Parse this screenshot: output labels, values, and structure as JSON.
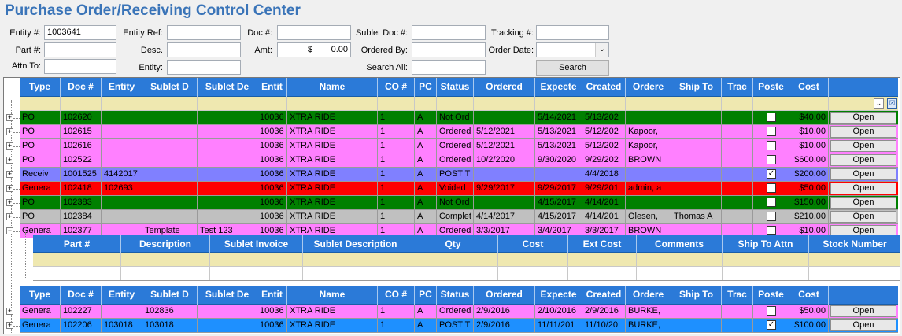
{
  "title": "Purchase Order/Receiving Control Center",
  "form": {
    "entity_num_label": "Entity #:",
    "entity_num_value": "1003641",
    "part_num_label": "Part #:",
    "part_num_value": "",
    "attn_to_label": "Attn To:",
    "attn_to_value": "",
    "entity_ref_label": "Entity Ref:",
    "entity_ref_value": "",
    "desc_label": "Desc.",
    "desc_value": "",
    "entity_label": "Entity:",
    "entity_value": "",
    "doc_num_label": "Doc #:",
    "doc_num_value": "",
    "amt_label": "Amt:",
    "amt_currency": "$",
    "amt_value": "0.00",
    "sublet_doc_label": "Sublet Doc #:",
    "sublet_doc_value": "",
    "ordered_by_label": "Ordered By:",
    "ordered_by_value": "",
    "search_all_label": "Search All:",
    "search_all_value": "",
    "tracking_label": "Tracking #:",
    "tracking_value": "",
    "order_date_label": "Order Date:",
    "order_date_value": "",
    "search_button": "Search"
  },
  "grid": {
    "columns": [
      "Type",
      "Doc #",
      "Entity",
      "Sublet D",
      "Sublet De",
      "Entit",
      "Name",
      "CO #",
      "PC",
      "Status",
      "Ordered",
      "Expecte",
      "Created",
      "Ordere",
      "Ship To",
      "Trac",
      "Poste",
      "Cost"
    ],
    "rows": [
      {
        "bg": "#008000",
        "cells": [
          "PO",
          "102620",
          "",
          "",
          "",
          "10036",
          "XTRA RIDE",
          "1",
          "A",
          "Not Ord",
          "",
          "5/14/2021",
          "5/13/202",
          "",
          "",
          "",
          ""
        ],
        "posted": false,
        "cost": "$40.00",
        "open": "Open"
      },
      {
        "bg": "#ff80ff",
        "cells": [
          "PO",
          "102615",
          "",
          "",
          "",
          "10036",
          "XTRA RIDE",
          "1",
          "A",
          "Ordered",
          "5/12/2021",
          "5/13/2021",
          "5/12/202",
          "Kapoor,",
          "",
          "",
          ""
        ],
        "posted": false,
        "cost": "$10.00",
        "open": "Open"
      },
      {
        "bg": "#ff80ff",
        "cells": [
          "PO",
          "102616",
          "",
          "",
          "",
          "10036",
          "XTRA RIDE",
          "1",
          "A",
          "Ordered",
          "5/12/2021",
          "5/13/2021",
          "5/12/202",
          "Kapoor,",
          "",
          "",
          ""
        ],
        "posted": false,
        "cost": "$10.00",
        "open": "Open"
      },
      {
        "bg": "#ff80ff",
        "cells": [
          "PO",
          "102522",
          "",
          "",
          "",
          "10036",
          "XTRA RIDE",
          "1",
          "A",
          "Ordered",
          "10/2/2020",
          "9/30/2020",
          "9/29/202",
          "BROWN",
          "",
          "",
          ""
        ],
        "posted": false,
        "cost": "$600.00",
        "open": "Open"
      },
      {
        "bg": "#8080ff",
        "cells": [
          "Receiv",
          "1001525",
          "4142017",
          "",
          "",
          "10036",
          "XTRA RIDE",
          "1",
          "A",
          "POST T",
          "",
          "",
          "4/4/2018",
          "",
          "",
          "",
          ""
        ],
        "posted": true,
        "cost": "$200.00",
        "open": "Open"
      },
      {
        "bg": "#ff0000",
        "cells": [
          "Genera",
          "102418",
          "102693",
          "",
          "",
          "10036",
          "XTRA RIDE",
          "1",
          "A",
          "Voided",
          "9/29/2017",
          "9/29/2017",
          "9/29/201",
          "admin, a",
          "",
          "",
          ""
        ],
        "posted": false,
        "cost": "$50.00",
        "open": "Open"
      },
      {
        "bg": "#008000",
        "cells": [
          "PO",
          "102383",
          "",
          "",
          "",
          "10036",
          "XTRA RIDE",
          "1",
          "A",
          "Not Ord",
          "",
          "4/15/2017",
          "4/14/201",
          "",
          "",
          "",
          ""
        ],
        "posted": false,
        "cost": "$150.00",
        "open": "Open"
      },
      {
        "bg": "#c0c0c0",
        "cells": [
          "PO",
          "102384",
          "",
          "",
          "",
          "10036",
          "XTRA RIDE",
          "1",
          "A",
          "Complet",
          "4/14/2017",
          "4/15/2017",
          "4/14/201",
          "Olesen,",
          "Thomas A",
          "",
          ""
        ],
        "posted": false,
        "cost": "$210.00",
        "open": "Open"
      },
      {
        "bg": "#ff80ff",
        "cells": [
          "Genera",
          "102377",
          "",
          "Template",
          "Test 123",
          "10036",
          "XTRA RIDE",
          "1",
          "A",
          "Ordered",
          "3/3/2017",
          "3/4/2017",
          "3/3/2017",
          "BROWN",
          "",
          "",
          ""
        ],
        "posted": false,
        "cost": "$10.00",
        "open": "Open",
        "expanded": true
      }
    ],
    "child_columns": [
      "Part #",
      "Description",
      "Sublet Invoice",
      "Sublet Description",
      "Qty",
      "Cost",
      "Ext Cost",
      "Comments",
      "Ship To Attn",
      "Stock Number"
    ],
    "rows2": [
      {
        "bg": "#ff80ff",
        "cells": [
          "Genera",
          "102227",
          "",
          "102836",
          "",
          "10036",
          "XTRA RIDE",
          "1",
          "A",
          "Ordered",
          "2/9/2016",
          "2/10/2016",
          "2/9/2016",
          "BURKE,",
          "",
          "",
          ""
        ],
        "posted": false,
        "cost": "$50.00",
        "open": "Open"
      },
      {
        "bg": "#1e90ff",
        "cells": [
          "Genera",
          "102206",
          "103018",
          "103018",
          "",
          "10036",
          "XTRA RIDE",
          "1",
          "A",
          "POST T",
          "2/9/2016",
          "11/11/201",
          "11/10/20",
          "BURKE,",
          "",
          "",
          ""
        ],
        "posted": true,
        "cost": "$100.00",
        "open": "Open"
      }
    ]
  },
  "colors": {
    "header": "#2b7ad8",
    "filter": "#efe8b0",
    "title": "#3a74b8"
  }
}
